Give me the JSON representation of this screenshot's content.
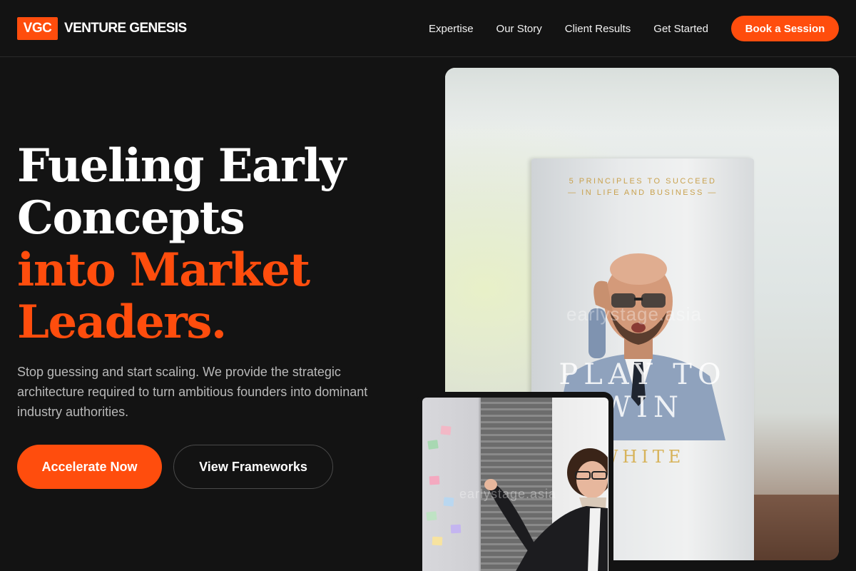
{
  "header": {
    "logo_badge": "VGC",
    "logo_text": "VENTURE GENESIS",
    "nav": [
      {
        "label": "Expertise"
      },
      {
        "label": "Our Story"
      },
      {
        "label": "Client Results"
      },
      {
        "label": "Get Started"
      }
    ],
    "cta_label": "Book a Session"
  },
  "hero": {
    "title_lines": [
      "Fueling Early",
      "Concepts"
    ],
    "title_accent_lines": [
      "into Market",
      "Leaders."
    ],
    "subtitle": "Stop guessing and start scaling. We provide the strategic architecture required to turn ambitious founders into dominant industry authorities.",
    "primary_button": "Accelerate Now",
    "secondary_button": "View Frameworks"
  },
  "media": {
    "book_principles_line1": "5 PRINCIPLES TO SUCCEED",
    "book_principles_line2": "— IN LIFE AND BUSINESS —",
    "book_title": "PLAY TO WIN",
    "book_author": "WHITE",
    "watermark": "earlystage.asia"
  },
  "colors": {
    "accent": "#ff4d0d",
    "background": "#131313",
    "text_muted": "#b9b9b9"
  }
}
